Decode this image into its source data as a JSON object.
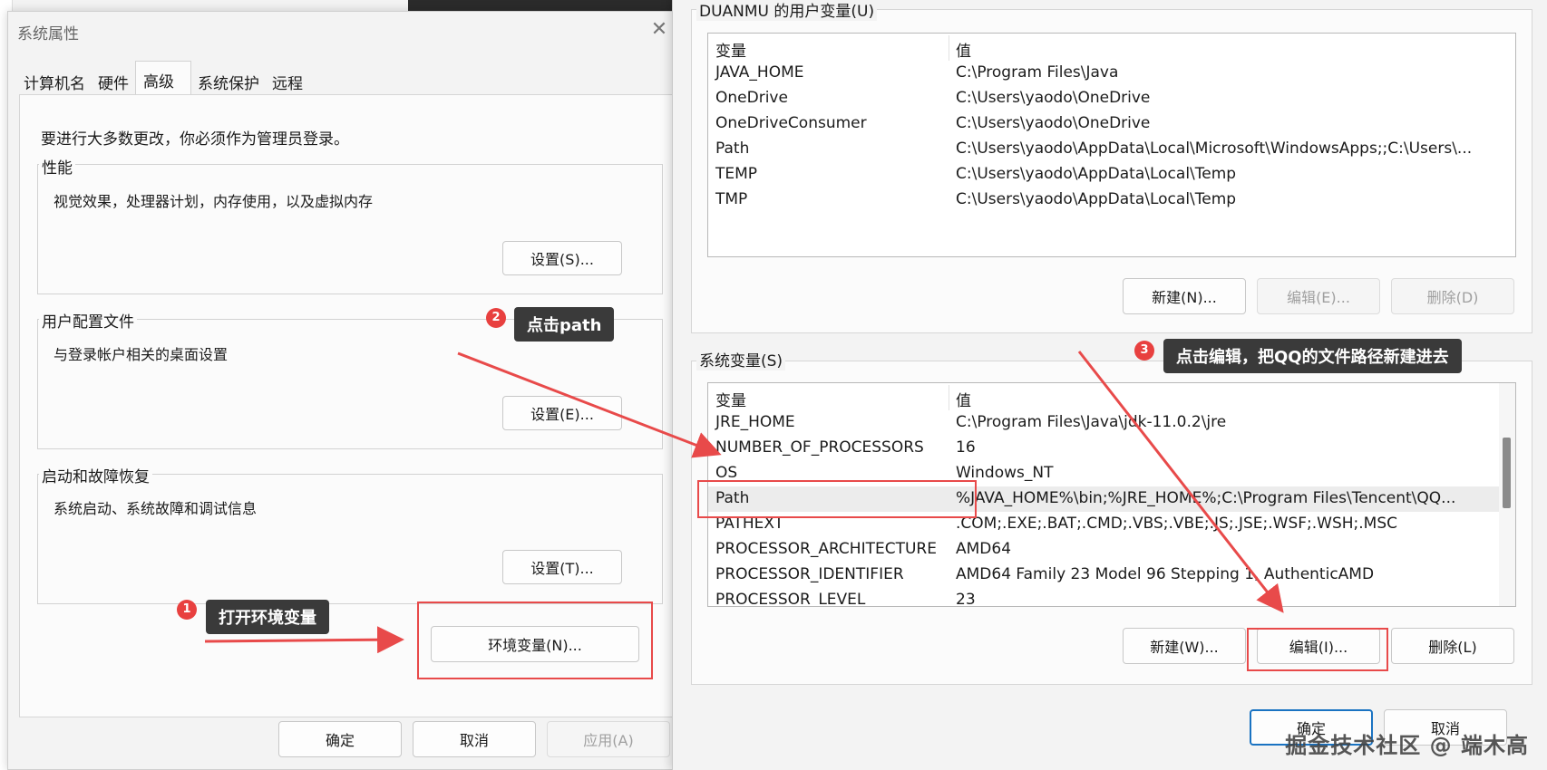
{
  "left_dialog": {
    "title": "系统属性",
    "tabs": [
      {
        "label": "计算机名"
      },
      {
        "label": "硬件"
      },
      {
        "label": "高级"
      },
      {
        "label": "系统保护"
      },
      {
        "label": "远程"
      }
    ],
    "notice": "要进行大多数更改，你必须作为管理员登录。",
    "performance": {
      "title": "性能",
      "desc": "视觉效果，处理器计划，内存使用，以及虚拟内存",
      "button": "设置(S)..."
    },
    "user_profiles": {
      "title": "用户配置文件",
      "desc": "与登录帐户相关的桌面设置",
      "button": "设置(E)..."
    },
    "startup_recovery": {
      "title": "启动和故障恢复",
      "desc": "系统启动、系统故障和调试信息",
      "button": "设置(T)..."
    },
    "env_button": "环境变量(N)...",
    "ok": "确定",
    "cancel": "取消",
    "apply": "应用(A)"
  },
  "right_dialog": {
    "user_vars": {
      "title": "DUANMU 的用户变量(U)",
      "columns": [
        "变量",
        "值"
      ],
      "rows": [
        {
          "name": "JAVA_HOME",
          "value": "C:\\Program Files\\Java"
        },
        {
          "name": "OneDrive",
          "value": "C:\\Users\\yaodo\\OneDrive"
        },
        {
          "name": "OneDriveConsumer",
          "value": "C:\\Users\\yaodo\\OneDrive"
        },
        {
          "name": "Path",
          "value": "C:\\Users\\yaodo\\AppData\\Local\\Microsoft\\WindowsApps;;C:\\Users\\..."
        },
        {
          "name": "TEMP",
          "value": "C:\\Users\\yaodo\\AppData\\Local\\Temp"
        },
        {
          "name": "TMP",
          "value": "C:\\Users\\yaodo\\AppData\\Local\\Temp"
        }
      ],
      "buttons": {
        "new": "新建(N)...",
        "edit": "编辑(E)...",
        "delete": "删除(D)"
      }
    },
    "system_vars": {
      "title": "系统变量(S)",
      "columns": [
        "变量",
        "值"
      ],
      "rows": [
        {
          "name": "JRE_HOME",
          "value": "C:\\Program Files\\Java\\jdk-11.0.2\\jre"
        },
        {
          "name": "NUMBER_OF_PROCESSORS",
          "value": "16"
        },
        {
          "name": "OS",
          "value": "Windows_NT"
        },
        {
          "name": "Path",
          "value": "%JAVA_HOME%\\bin;%JRE_HOME%;C:\\Program Files\\Tencent\\QQ..."
        },
        {
          "name": "PATHEXT",
          "value": ".COM;.EXE;.BAT;.CMD;.VBS;.VBE;.JS;.JSE;.WSF;.WSH;.MSC"
        },
        {
          "name": "PROCESSOR_ARCHITECTURE",
          "value": "AMD64"
        },
        {
          "name": "PROCESSOR_IDENTIFIER",
          "value": "AMD64 Family 23 Model 96 Stepping 1, AuthenticAMD"
        },
        {
          "name": "PROCESSOR_LEVEL",
          "value": "23"
        }
      ],
      "buttons": {
        "new": "新建(W)...",
        "edit": "编辑(I)...",
        "delete": "删除(L)"
      }
    },
    "ok": "确定",
    "cancel": "取消"
  },
  "annotations": {
    "step1": {
      "num": "1",
      "text": "打开环境变量"
    },
    "step2": {
      "num": "2",
      "text": "点击path"
    },
    "step3": {
      "num": "3",
      "text": "点击编辑，把QQ的文件路径新建进去"
    }
  },
  "watermark": "掘金技术社区 @ 端木高",
  "colors": {
    "annotation_red": "#e84a4a",
    "callout_bg": "#3a3a3a",
    "accent_blue": "#1a73c2"
  }
}
